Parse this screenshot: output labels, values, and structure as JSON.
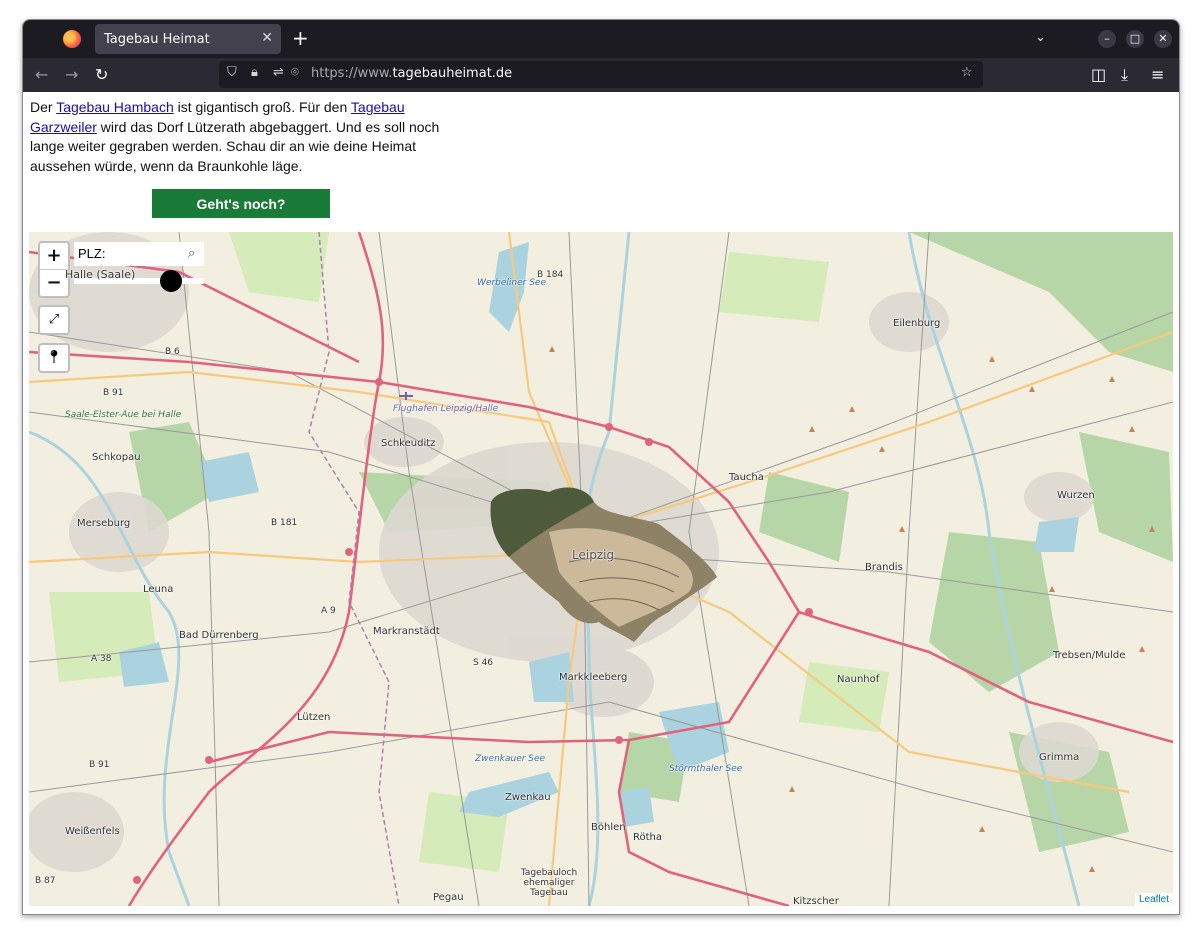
{
  "browser": {
    "tab_title": "Tagebau Heimat",
    "url_prefix": "https://www.",
    "url_domain": "tagebauheimat.de"
  },
  "intro": {
    "t1": "Der ",
    "link1": "Tagebau Hambach",
    "t2": " ist gigantisch groß. Für den ",
    "link2": "Tagebau Garzweiler",
    "t3": " wird das Dorf Lützerath abgebaggert. Und es soll noch lange weiter gegraben werden. Schau dir an wie deine Heimat aussehen würde, wenn da Braunkohle läge."
  },
  "button_label": "Geht's noch?",
  "map": {
    "plz_label": "PLZ:",
    "zoom_in": "+",
    "zoom_out": "−",
    "attribution": "Leaflet",
    "places": [
      "Halle (Saale)",
      "Werbeliner See",
      "B 184",
      "Eilenburg",
      "B 6",
      "B 91",
      "Flughafen Leipzig/Halle",
      "Saale-Elster-Aue bei Halle",
      "Schkeuditz",
      "Schkopau",
      "Taucha",
      "Wurzen",
      "Merseburg",
      "B 181",
      "Leipzig",
      "Brandis",
      "Leuna",
      "A 9",
      "Bad Dürrenberg",
      "Markranstädt",
      "A 38",
      "S 46",
      "Markkleeberg",
      "Naunhof",
      "Trebsen/Mulde",
      "Lützen",
      "Grimma",
      "B 91",
      "Zwenkauer See",
      "Störmthaler See",
      "Zwenkau",
      "Weißenfels",
      "Böhlen",
      "Rötha",
      "Tagebauloch ehemaliger Tagebau",
      "B 87",
      "Pegau",
      "Kitzscher"
    ]
  }
}
